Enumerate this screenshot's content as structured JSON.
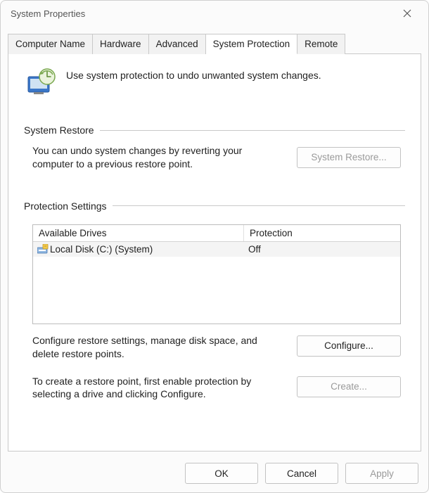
{
  "window": {
    "title": "System Properties"
  },
  "tabs": {
    "computer_name": "Computer Name",
    "hardware": "Hardware",
    "advanced": "Advanced",
    "system_protection": "System Protection",
    "remote": "Remote",
    "active": "system_protection"
  },
  "hero_text": "Use system protection to undo unwanted system changes.",
  "sections": {
    "restore": {
      "title": "System Restore",
      "desc": "You can undo system changes by reverting your computer to a previous restore point.",
      "button": "System Restore...",
      "button_enabled": false
    },
    "protection": {
      "title": "Protection Settings",
      "columns": {
        "drives": "Available Drives",
        "protection": "Protection"
      },
      "drives": [
        {
          "name": "Local Disk (C:) (System)",
          "protection": "Off"
        }
      ],
      "configure_desc": "Configure restore settings, manage disk space, and delete restore points.",
      "configure_button": "Configure...",
      "create_desc": "To create a restore point, first enable protection by selecting a drive and clicking Configure.",
      "create_button": "Create...",
      "create_enabled": false
    }
  },
  "footer": {
    "ok": "OK",
    "cancel": "Cancel",
    "apply": "Apply",
    "apply_enabled": false
  }
}
